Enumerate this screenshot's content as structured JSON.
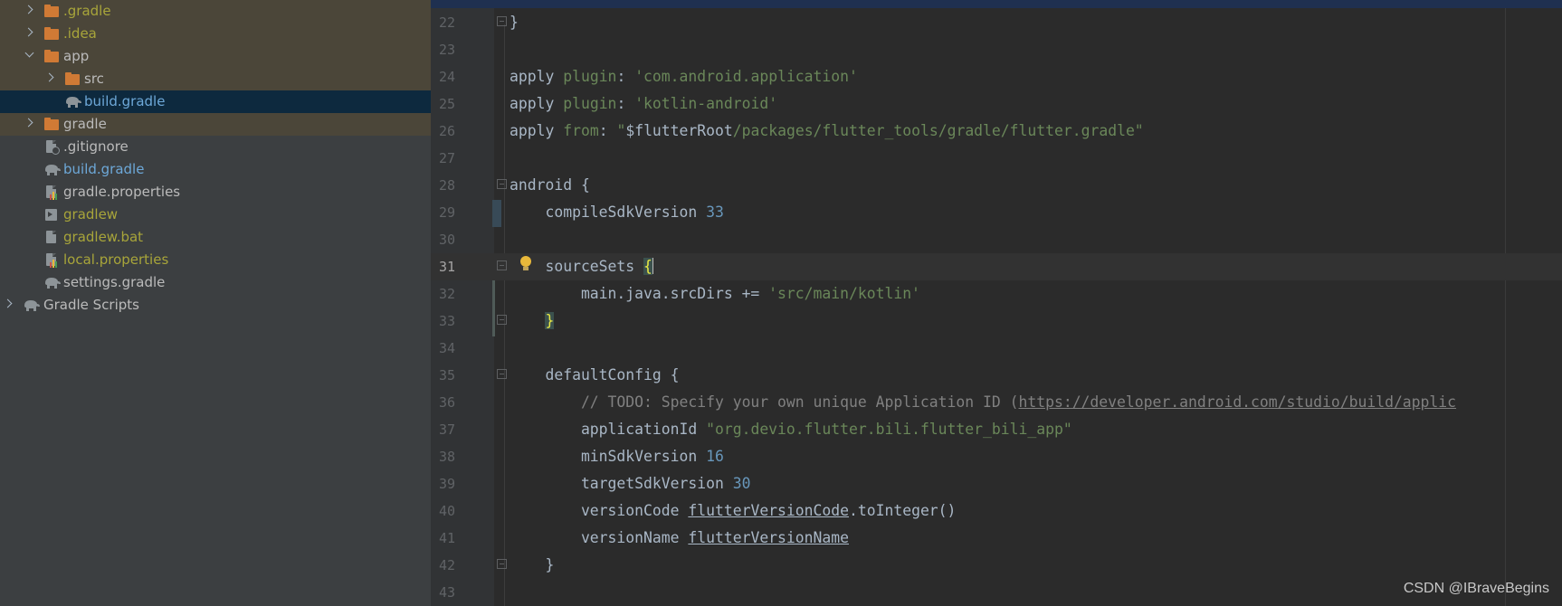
{
  "project_tree": {
    "items": [
      {
        "label": ".gradle"
      },
      {
        "label": ".idea"
      },
      {
        "label": "app"
      },
      {
        "label": "src"
      },
      {
        "label": "build.gradle"
      },
      {
        "label": "gradle"
      },
      {
        "label": ".gitignore"
      },
      {
        "label": "build.gradle"
      },
      {
        "label": "gradle.properties"
      },
      {
        "label": "gradlew"
      },
      {
        "label": "gradlew.bat"
      },
      {
        "label": "local.properties"
      },
      {
        "label": "settings.gradle"
      },
      {
        "label": "Gradle Scripts"
      }
    ]
  },
  "editor": {
    "lines": [
      {
        "num": "22",
        "segs": [
          {
            "t": "}",
            "c": "k"
          }
        ]
      },
      {
        "num": "23",
        "segs": []
      },
      {
        "num": "24",
        "segs": [
          {
            "t": "apply ",
            "c": "k"
          },
          {
            "t": "plugin",
            "c": "g"
          },
          {
            "t": ": ",
            "c": "k"
          },
          {
            "t": "'com.android.application'",
            "c": "g"
          }
        ]
      },
      {
        "num": "25",
        "segs": [
          {
            "t": "apply ",
            "c": "k"
          },
          {
            "t": "plugin",
            "c": "g"
          },
          {
            "t": ": ",
            "c": "k"
          },
          {
            "t": "'kotlin-android'",
            "c": "g"
          }
        ]
      },
      {
        "num": "26",
        "segs": [
          {
            "t": "apply ",
            "c": "k"
          },
          {
            "t": "from",
            "c": "g"
          },
          {
            "t": ": ",
            "c": "k"
          },
          {
            "t": "\"",
            "c": "g"
          },
          {
            "t": "$flutterRoot",
            "c": "k"
          },
          {
            "t": "/packages/flutter_tools/gradle/flutter.gradle\"",
            "c": "g"
          }
        ]
      },
      {
        "num": "27",
        "segs": []
      },
      {
        "num": "28",
        "segs": [
          {
            "t": "android {",
            "c": "k"
          }
        ]
      },
      {
        "num": "29",
        "segs": [
          {
            "t": "    compileSdkVersion ",
            "c": "k"
          },
          {
            "t": "33",
            "c": "n"
          }
        ]
      },
      {
        "num": "30",
        "segs": []
      },
      {
        "num": "31",
        "segs": [
          {
            "t": "    sourceSets ",
            "c": "k"
          },
          {
            "t": "{",
            "c": "bm"
          }
        ]
      },
      {
        "num": "32",
        "segs": [
          {
            "t": "        main.java.srcDirs += ",
            "c": "k"
          },
          {
            "t": "'src/main/kotlin'",
            "c": "g"
          }
        ]
      },
      {
        "num": "33",
        "segs": [
          {
            "t": "    ",
            "c": "k"
          },
          {
            "t": "}",
            "c": "bm"
          }
        ]
      },
      {
        "num": "34",
        "segs": []
      },
      {
        "num": "35",
        "segs": [
          {
            "t": "    defaultConfig {",
            "c": "k"
          }
        ]
      },
      {
        "num": "36",
        "segs": [
          {
            "t": "        // TODO: Specify your own unique Application ID (",
            "c": "cm"
          },
          {
            "t": "https://developer.android.com/studio/build/applic",
            "c": "cm ul"
          }
        ]
      },
      {
        "num": "37",
        "segs": [
          {
            "t": "        applicationId ",
            "c": "k"
          },
          {
            "t": "\"org.devio.flutter.bili.flutter_bili_app\"",
            "c": "g"
          }
        ]
      },
      {
        "num": "38",
        "segs": [
          {
            "t": "        minSdkVersion ",
            "c": "k"
          },
          {
            "t": "16",
            "c": "n"
          }
        ]
      },
      {
        "num": "39",
        "segs": [
          {
            "t": "        targetSdkVersion ",
            "c": "k"
          },
          {
            "t": "30",
            "c": "n"
          }
        ]
      },
      {
        "num": "40",
        "segs": [
          {
            "t": "        versionCode ",
            "c": "k"
          },
          {
            "t": "flutterVersionCode",
            "c": "k ul"
          },
          {
            "t": ".toInteger()",
            "c": "k"
          }
        ]
      },
      {
        "num": "41",
        "segs": [
          {
            "t": "        versionName ",
            "c": "k"
          },
          {
            "t": "flutterVersionName",
            "c": "k ul"
          }
        ]
      },
      {
        "num": "42",
        "segs": [
          {
            "t": "    }",
            "c": "k"
          }
        ]
      },
      {
        "num": "43",
        "segs": []
      }
    ]
  },
  "watermark": "CSDN @IBraveBegins"
}
